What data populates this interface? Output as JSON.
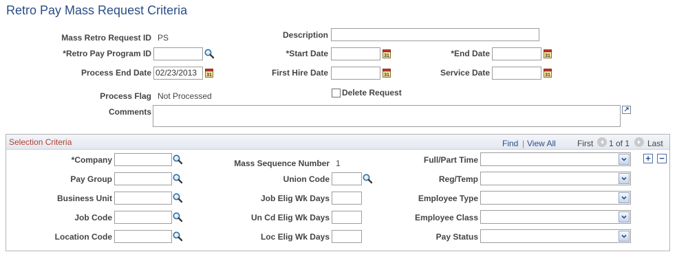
{
  "page": {
    "title": "Retro Pay Mass Request Criteria"
  },
  "header": {
    "mass_retro_request_id": {
      "label": "Mass Retro Request ID",
      "value": "PS"
    },
    "description": {
      "label": "Description",
      "value": ""
    },
    "retro_pay_program_id": {
      "label": "*Retro Pay Program ID",
      "value": ""
    },
    "start_date": {
      "label": "*Start Date",
      "value": ""
    },
    "end_date": {
      "label": "*End Date",
      "value": ""
    },
    "process_end_date": {
      "label": "Process End Date",
      "value": "02/23/2013"
    },
    "first_hire_date": {
      "label": "First Hire Date",
      "value": ""
    },
    "service_date": {
      "label": "Service Date",
      "value": ""
    },
    "process_flag": {
      "label": "Process Flag",
      "value": "Not Processed"
    },
    "delete_request": {
      "label": "Delete Request",
      "checked": false
    },
    "comments": {
      "label": "Comments",
      "value": ""
    }
  },
  "selection": {
    "title": "Selection Criteria",
    "find": "Find",
    "separator": "|",
    "view_all": "View All",
    "first": "First",
    "range": "1 of 1",
    "last": "Last",
    "company": {
      "label": "*Company",
      "value": ""
    },
    "pay_group": {
      "label": "Pay Group",
      "value": ""
    },
    "business_unit": {
      "label": "Business Unit",
      "value": ""
    },
    "job_code": {
      "label": "Job Code",
      "value": ""
    },
    "location_code": {
      "label": "Location Code",
      "value": ""
    },
    "mass_sequence_number": {
      "label": "Mass Sequence Number",
      "value": "1"
    },
    "union_code": {
      "label": "Union Code",
      "value": ""
    },
    "job_elig_wk_days": {
      "label": "Job Elig Wk Days",
      "value": ""
    },
    "un_cd_elig_wk_days": {
      "label": "Un Cd Elig Wk Days",
      "value": ""
    },
    "loc_elig_wk_days": {
      "label": "Loc Elig Wk Days",
      "value": ""
    },
    "full_part_time": {
      "label": "Full/Part Time",
      "value": ""
    },
    "reg_temp": {
      "label": "Reg/Temp",
      "value": ""
    },
    "employee_type": {
      "label": "Employee Type",
      "value": ""
    },
    "employee_class": {
      "label": "Employee Class",
      "value": ""
    },
    "pay_status": {
      "label": "Pay Status",
      "value": ""
    },
    "add_row": "+",
    "delete_row": "−"
  },
  "icons": {
    "lookup": "magnifier-icon",
    "calendar": "calendar-icon",
    "dropdown": "chevron-down-icon",
    "expand": "expand-icon"
  },
  "colors": {
    "title": "#2a4d86",
    "section_title": "#b04030",
    "link": "#2b4d8c"
  }
}
